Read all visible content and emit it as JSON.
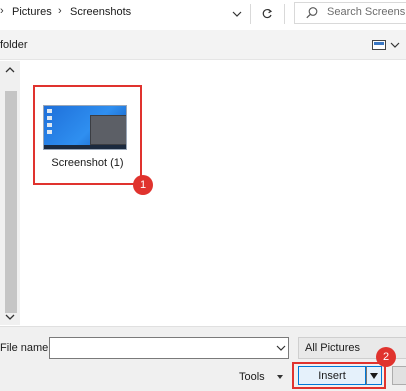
{
  "address_bar": {
    "breadcrumb": [
      "Pictures",
      "Screenshots"
    ],
    "separator": "›",
    "search_placeholder": "Search Screensh"
  },
  "toolbar": {
    "new_folder_label": "folder"
  },
  "files": [
    {
      "name": "Screenshot (1)"
    }
  ],
  "annotations": {
    "step_1": "1",
    "step_2": "2",
    "highlight_color": "#e0332e"
  },
  "bottom": {
    "file_name_label": "File name:",
    "file_name_value": "",
    "filter_selected": "All Pictures",
    "tools_label": "Tools",
    "insert_label": "Insert"
  },
  "colors": {
    "accent": "#0078d7",
    "button_bg": "#e5f1fb"
  }
}
